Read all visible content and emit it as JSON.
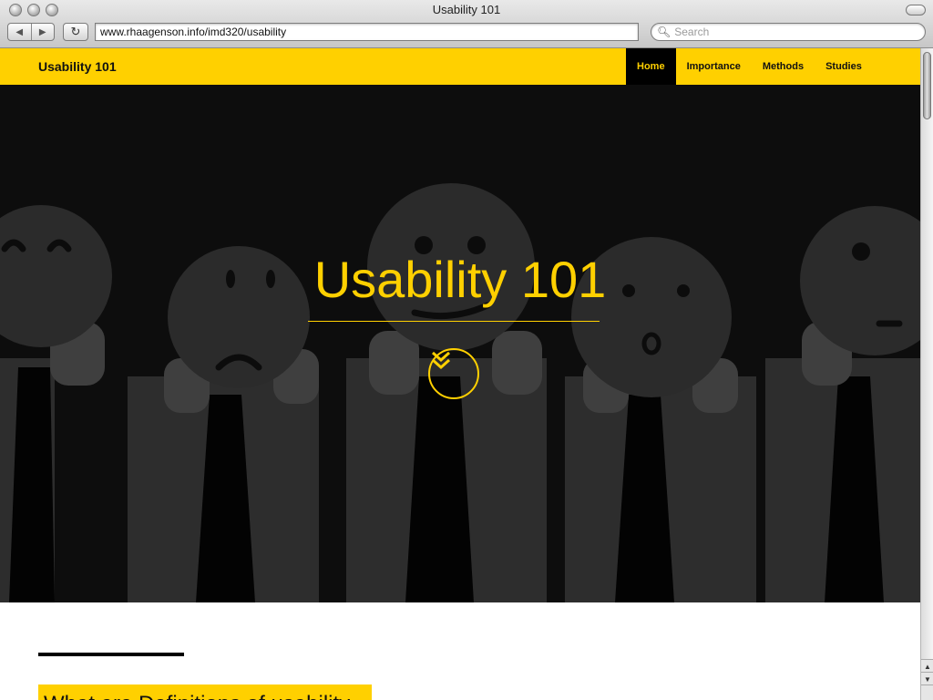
{
  "window": {
    "title": "Usability 101",
    "url": "www.rhaagenson.info/imd320/usability",
    "search_placeholder": "Search"
  },
  "site": {
    "brand": "Usability 101",
    "nav": [
      {
        "label": "Home",
        "active": true
      },
      {
        "label": "Importance",
        "active": false
      },
      {
        "label": "Methods",
        "active": false
      },
      {
        "label": "Studies",
        "active": false
      }
    ]
  },
  "hero": {
    "title": "Usability 101",
    "down_icon": "double-chevron-down-icon"
  },
  "section": {
    "heading": "What are Definitions of usability"
  },
  "colors": {
    "accent": "#ffd000",
    "hero_bg": "#111111"
  }
}
